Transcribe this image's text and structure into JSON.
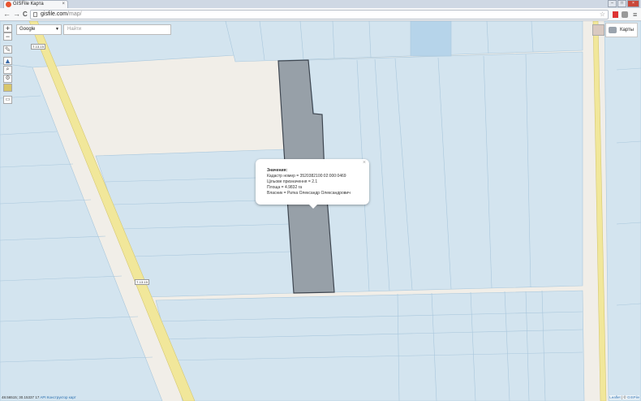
{
  "browser": {
    "tab_title": "GISFile Карта",
    "tab_close": "×",
    "url_host": "gisfile.com",
    "url_path": "/map/",
    "back": "←",
    "forward": "→",
    "reload": "C",
    "star": "☆",
    "menu": "≡"
  },
  "window": {
    "minimize": "–",
    "maximize": "□",
    "close": "×"
  },
  "map": {
    "zoom_in": "+",
    "zoom_out": "−",
    "basemap": "Google",
    "basemap_arrow": "▼",
    "search_placeholder": "Найти",
    "maps_button": "Карты",
    "road_label_top": "Т-13-15",
    "road_label_bottom": "Т-13-15",
    "popup": {
      "heading": "Значения:",
      "line1": "Кадастр номер = 3520382100:02:000:0469",
      "line2": "Цільове призначення = 2.1",
      "line3": "Площа = 4.9832 га",
      "line4": "Власник = Ратка Олександр Олександрович",
      "close": "×"
    },
    "coords": "48.56515; 30.15337",
    "zoom_level": "17",
    "api_link": "API",
    "builder_link": "Конструктор карт",
    "attribution_leaflet": "Leaflet",
    "attribution_sep": " | © ",
    "attribution_gisfile": "GISFile"
  },
  "colors": {
    "field_fill": "#d3e4ef",
    "parcel_fill": "#97a0a8",
    "road_yellow": "#f1e79a",
    "background": "#f1eee8"
  }
}
